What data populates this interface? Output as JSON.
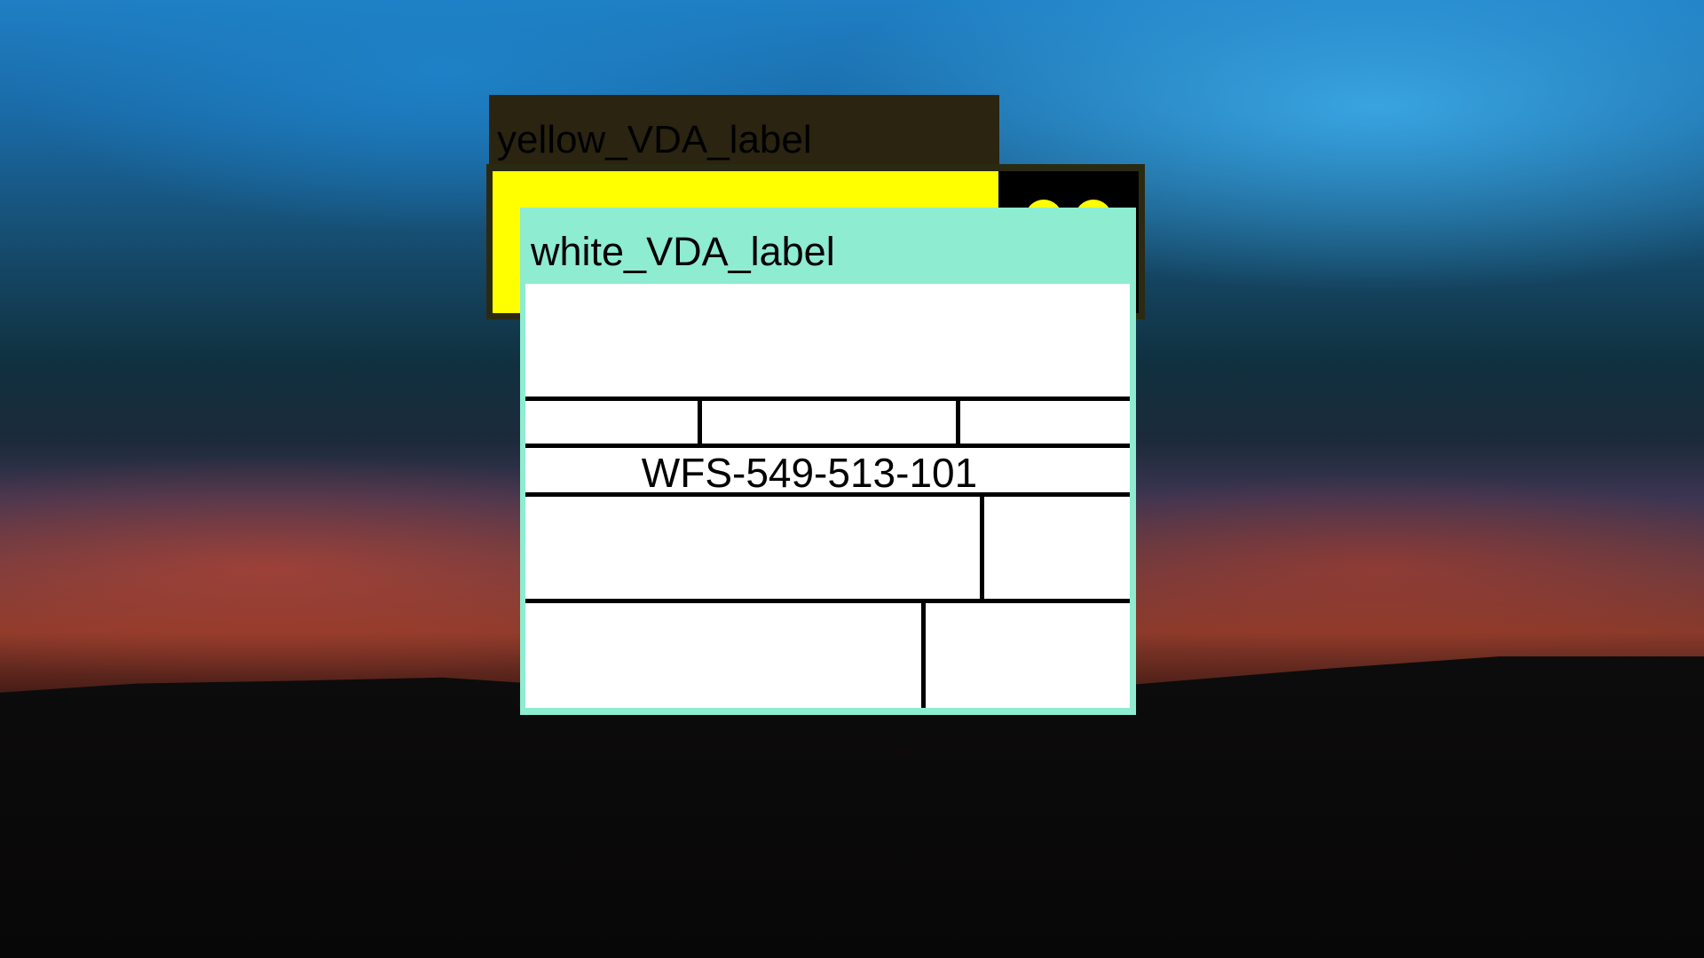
{
  "desktop": {
    "wallpaper": "dusk-sky"
  },
  "yellow_window": {
    "label": "yellow_VDA_label",
    "body_text": "",
    "colors": {
      "body": "#ffff00",
      "label_bar": "#2a2410",
      "panel": "#000000"
    }
  },
  "white_window": {
    "label": "white_VDA_label",
    "tracking_number": "WFS-549-513-101",
    "colors": {
      "frame": "#8eecd0",
      "form": "#ffffff",
      "lines": "#000000"
    }
  }
}
